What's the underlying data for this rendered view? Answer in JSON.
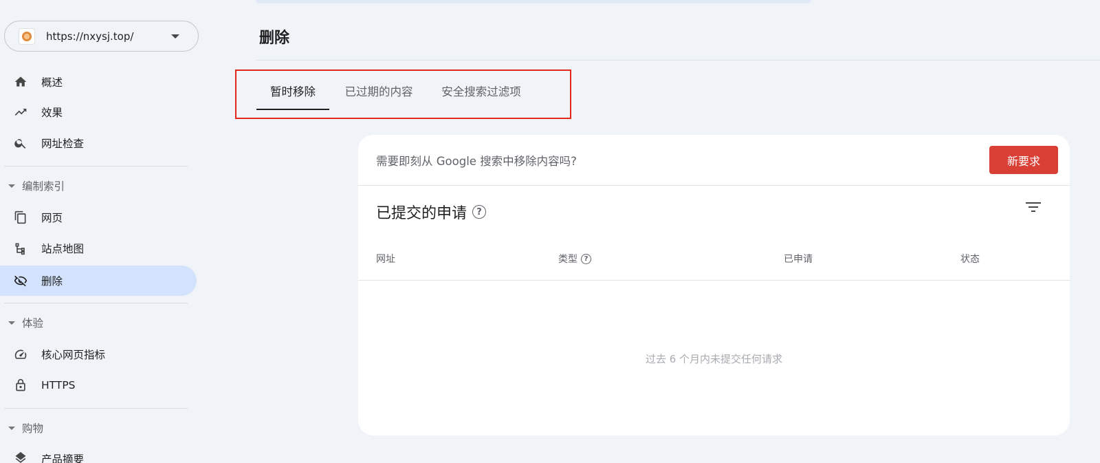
{
  "property": {
    "url": "https://nxysj.top/"
  },
  "sidebar": {
    "top_items": [
      {
        "label": "概述",
        "icon": "home-icon"
      },
      {
        "label": "效果",
        "icon": "trending-up-icon"
      },
      {
        "label": "网址检查",
        "icon": "search-icon"
      }
    ],
    "sections": [
      {
        "label": "编制索引",
        "items": [
          {
            "label": "网页",
            "icon": "pages-icon"
          },
          {
            "label": "站点地图",
            "icon": "sitemap-icon"
          },
          {
            "label": "删除",
            "icon": "eye-off-icon",
            "active": true
          }
        ]
      },
      {
        "label": "体验",
        "items": [
          {
            "label": "核心网页指标",
            "icon": "speed-icon"
          },
          {
            "label": "HTTPS",
            "icon": "lock-icon"
          }
        ]
      },
      {
        "label": "购物",
        "items": [
          {
            "label": "产品摘要",
            "icon": "layers-icon"
          }
        ]
      }
    ]
  },
  "main": {
    "title": "删除",
    "tabs": [
      {
        "label": "暂时移除",
        "active": true
      },
      {
        "label": "已过期的内容",
        "active": false
      },
      {
        "label": "安全搜索过滤项",
        "active": false
      }
    ],
    "card": {
      "prompt": "需要即刻从 Google 搜索中移除内容吗?",
      "new_request_label": "新要求",
      "section_title": "已提交的申请",
      "columns": [
        "网址",
        "类型",
        "已申请",
        "状态"
      ],
      "empty_message": "过去 6 个月内未提交任何请求"
    }
  },
  "colors": {
    "accent": "#d3e3fd",
    "primary_button": "#d93f34",
    "highlight_border": "#e0271a",
    "background": "#f0f4f9"
  }
}
